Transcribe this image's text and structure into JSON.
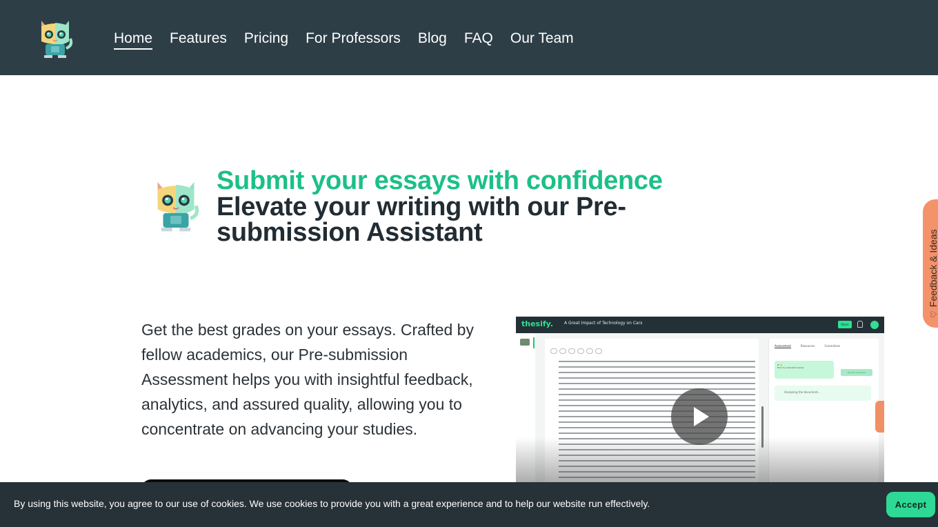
{
  "nav": {
    "logo_icon": "cat-robot-mascot-logo",
    "links": [
      {
        "label": "Home",
        "active": true
      },
      {
        "label": "Features",
        "active": false
      },
      {
        "label": "Pricing",
        "active": false
      },
      {
        "label": "For Professors",
        "active": false
      },
      {
        "label": "Blog",
        "active": false
      },
      {
        "label": "FAQ",
        "active": false
      },
      {
        "label": "Our Team",
        "active": false
      }
    ]
  },
  "hero": {
    "mascot_icon": "cat-robot-mascot",
    "title_green": "Submit your essays with confidence",
    "title_dark": "Elevate your writing with our Pre-submission Assistant",
    "description": "Get the best grades on your essays. Crafted by fellow academics, our Pre-submission Assessment helps you with insightful feedback, analytics, and assured quality, allowing you to concentrate on advancing your studies."
  },
  "video": {
    "app_brand": "thesify.",
    "doc_title": "A Great Impact of Technology on Cars",
    "share_label": "Share",
    "panel_tabs": [
      "Assessment",
      "Resources",
      "Corrections"
    ],
    "bubble_greeting": "Hi 👋",
    "bubble_text": "Find my evaluation below",
    "refresh_label": "Refresh feedback",
    "analyzing_text": "Analyzing the document...",
    "play_icon": "play-icon"
  },
  "feedback_tab": {
    "label": "Feedback & Ideas",
    "icon": "♡"
  },
  "colors": {
    "nav_bg": "#2d3e47",
    "accent_green": "#1cc087",
    "heading_dark": "#222c33",
    "cookie_bg": "#263238",
    "accept_bg": "#2ed996",
    "feedback_orange": "#f4926a"
  },
  "cookie": {
    "text": "By using this website, you agree to our use of cookies. We use cookies to provide you with a great experience and to help our website run effectively.",
    "accept_label": "Accept"
  }
}
